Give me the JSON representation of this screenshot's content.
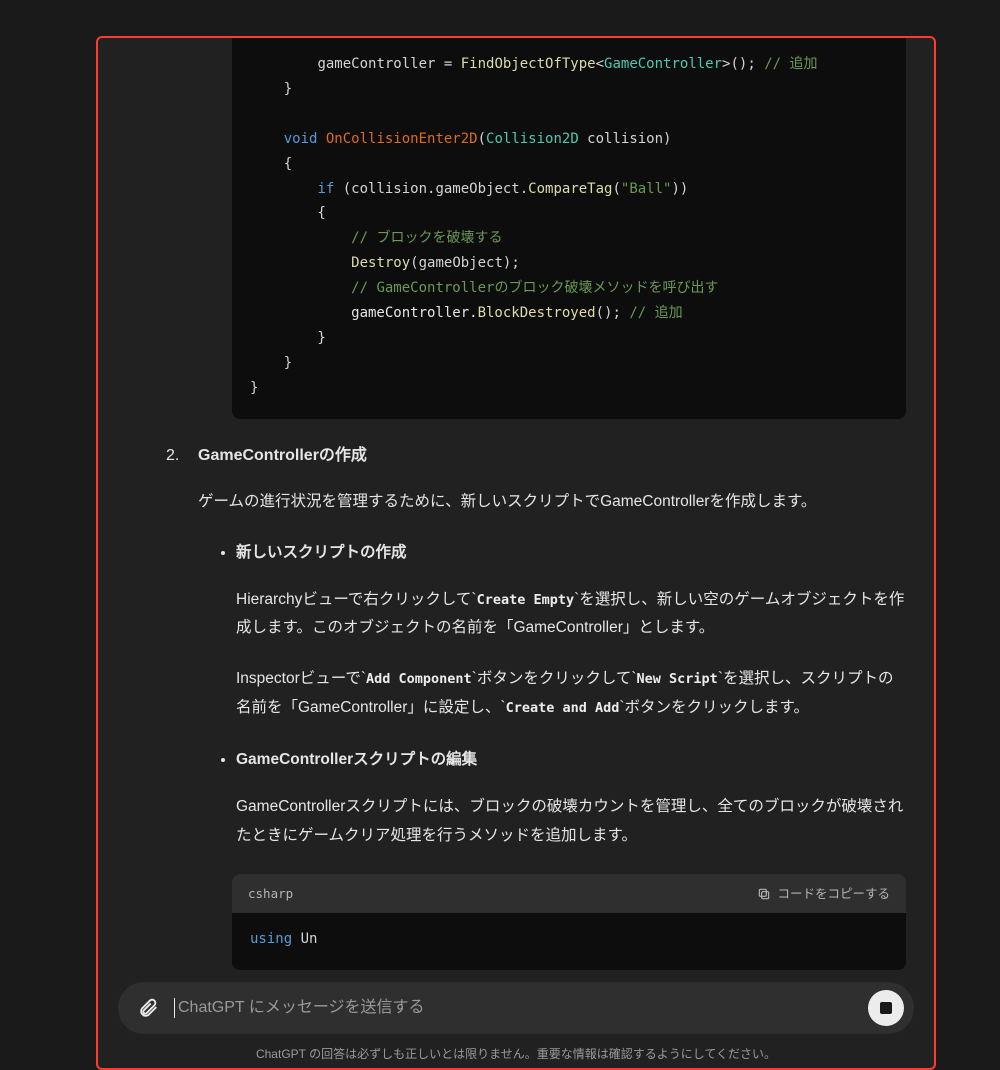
{
  "code1": {
    "l1_a": "gameController = ",
    "l1_b": "FindObjectOfType",
    "l1_c": "<",
    "l1_d": "GameController",
    "l1_e": ">(); ",
    "l1_f": "// 追加",
    "l2": "    }",
    "l3": "",
    "l4_a": "    ",
    "l4_b": "void",
    "l4_c": " ",
    "l4_d": "OnCollisionEnter2D",
    "l4_e": "(",
    "l4_f": "Collision2D",
    "l4_g": " collision)",
    "l5": "    {",
    "l6_a": "        ",
    "l6_b": "if",
    "l6_c": " (collision.gameObject.",
    "l6_d": "CompareTag",
    "l6_e": "(",
    "l6_f": "\"Ball\"",
    "l6_g": "))",
    "l7": "        {",
    "l8_a": "            ",
    "l8_b": "// ブロックを破壊する",
    "l9_a": "            ",
    "l9_b": "Destroy",
    "l9_c": "(gameObject);",
    "l10_a": "            ",
    "l10_b": "// GameControllerのブロック破壊メソッドを呼び出す",
    "l11_a": "            gameController.",
    "l11_b": "BlockDestroyed",
    "l11_c": "(); ",
    "l11_d": "// 追加",
    "l12": "        }",
    "l13": "    }",
    "l14": "}"
  },
  "step": {
    "num": "2.",
    "title": "GameControllerの作成"
  },
  "para1": "ゲームの進行状況を管理するために、新しいスクリプトでGameControllerを作成します。",
  "sub1": {
    "title": "新しいスクリプトの作成",
    "p1_a": "Hierarchyビューで右クリックして`",
    "p1_b": "Create Empty",
    "p1_c": "`を選択し、新しい空のゲームオブジェクトを作成します。このオブジェクトの名前を「GameController」とします。",
    "p2_a": "Inspectorビューで`",
    "p2_b": "Add Component",
    "p2_c": "`ボタンをクリックして`",
    "p2_d": "New Script",
    "p2_e": "`を選択し、スクリプトの名前を「GameController」に設定し、`",
    "p2_f": "Create and Add",
    "p2_g": "`ボタンをクリックします。"
  },
  "sub2": {
    "title": "GameControllerスクリプトの編集",
    "p1": "GameControllerスクリプトには、ブロックの破壊カウントを管理し、全てのブロックが破壊されたときにゲームクリア処理を行うメソッドを追加します。"
  },
  "code2": {
    "lang": "csharp",
    "copy": "コードをコピーする",
    "l1_a": "using",
    "l1_b": " Un"
  },
  "input": {
    "placeholder": "ChatGPT にメッセージを送信する"
  },
  "disclaimer": "ChatGPT の回答は必ずしも正しいとは限りません。重要な情報は確認するようにしてください。"
}
